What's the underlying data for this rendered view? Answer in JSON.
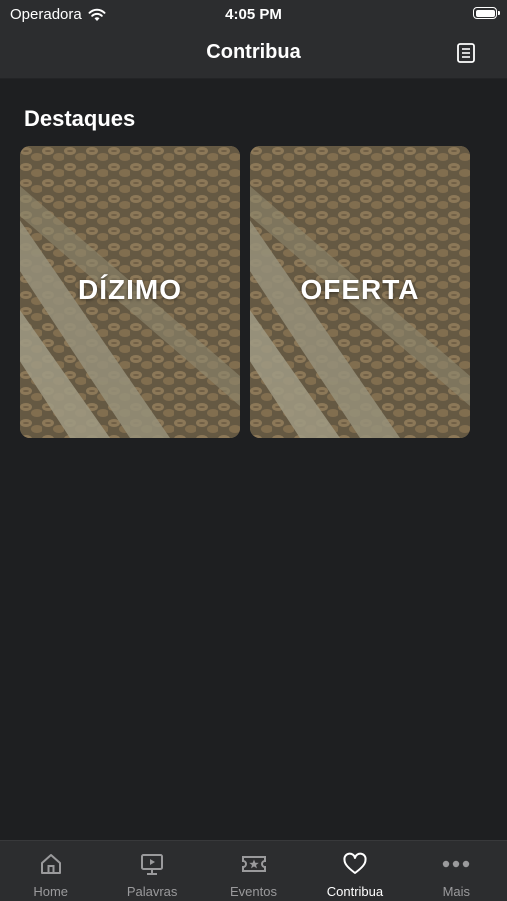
{
  "status": {
    "carrier": "Operadora",
    "time": "4:05 PM"
  },
  "header": {
    "title": "Contribua"
  },
  "section": {
    "title": "Destaques"
  },
  "cards": [
    {
      "label": "DÍZIMO"
    },
    {
      "label": "OFERTA"
    }
  ],
  "tabs": [
    {
      "label": "Home",
      "icon": "home-icon"
    },
    {
      "label": "Palavras",
      "icon": "play-screen-icon"
    },
    {
      "label": "Eventos",
      "icon": "ticket-icon"
    },
    {
      "label": "Contribua",
      "icon": "heart-icon",
      "active": true
    },
    {
      "label": "Mais",
      "icon": "more-icon"
    }
  ],
  "colors": {
    "background": "#1e1f21",
    "bar": "#2c2d2f",
    "active_tab": "#ffffff",
    "inactive_tab": "#9a9a9c"
  }
}
